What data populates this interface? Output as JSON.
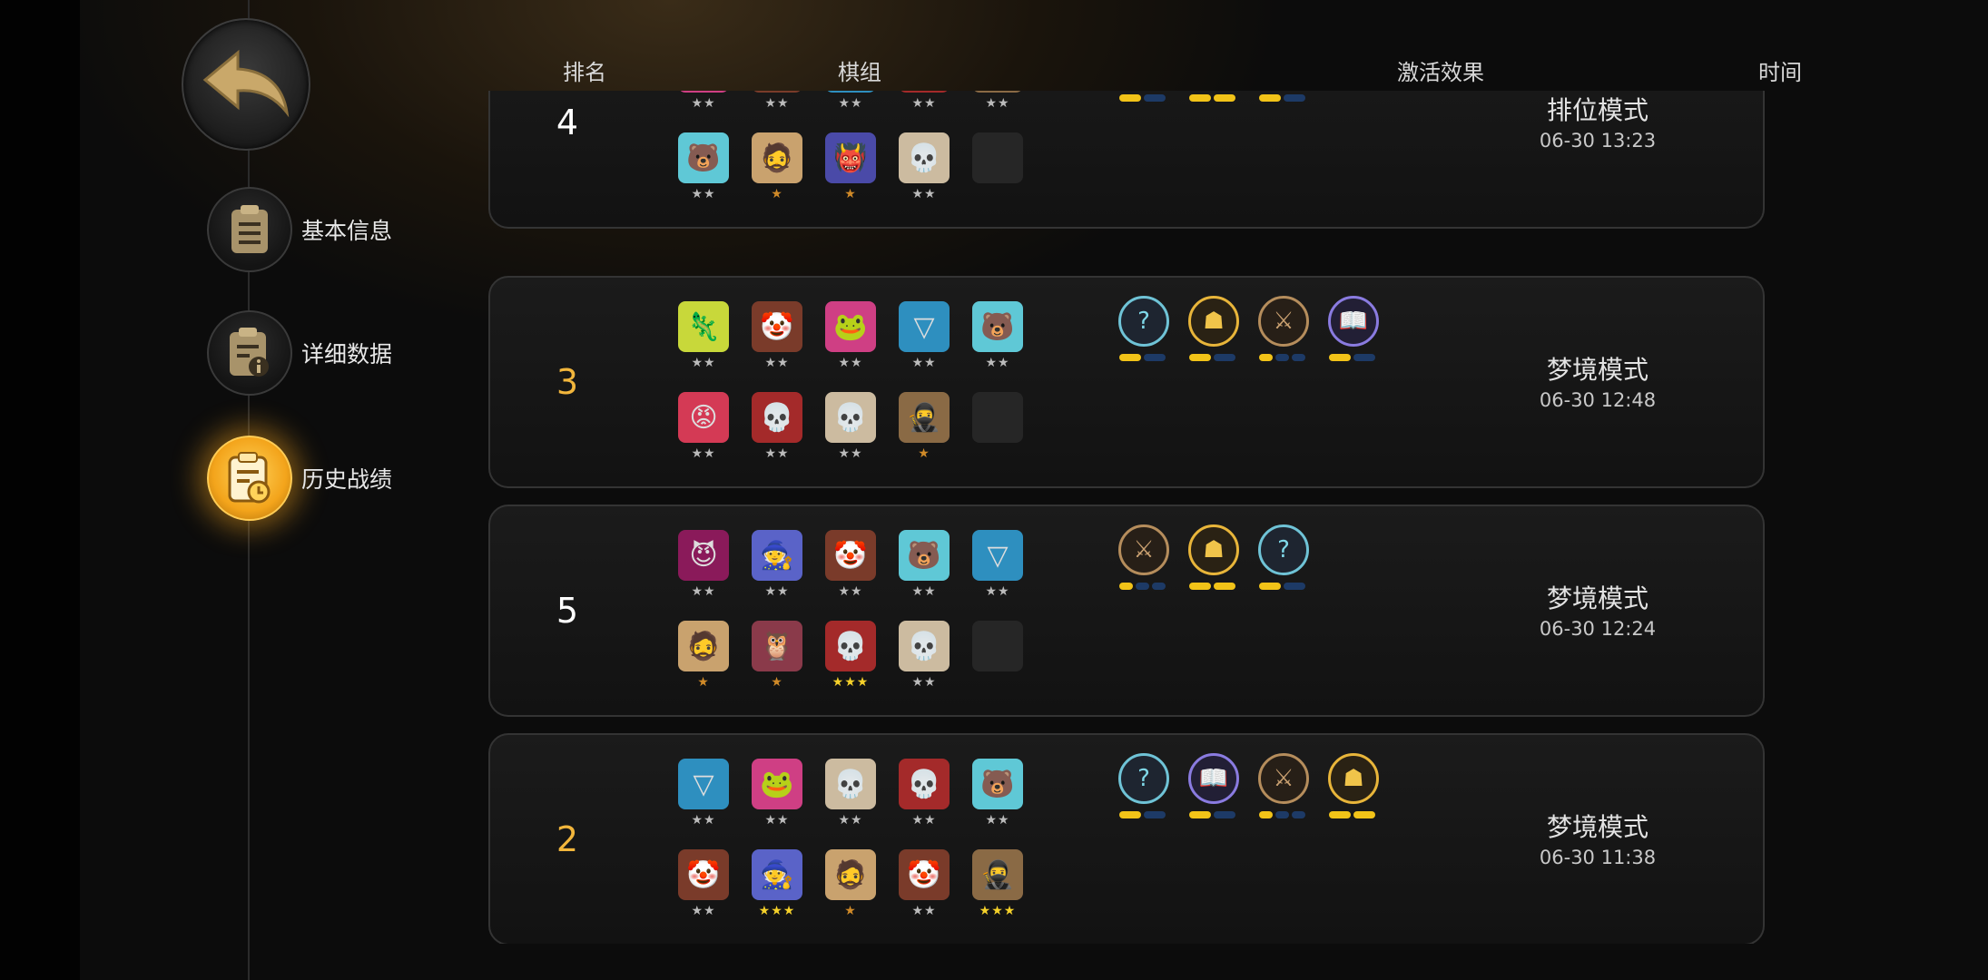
{
  "nav": {
    "back_label": "",
    "items": [
      {
        "label": "基本信息",
        "icon": "clipboard-icon",
        "active": false
      },
      {
        "label": "详细数据",
        "icon": "clipboard-info-icon",
        "active": false
      },
      {
        "label": "历史战绩",
        "icon": "clipboard-history-icon",
        "active": true
      }
    ]
  },
  "header": {
    "rank": "排名",
    "pieces": "棋组",
    "effects": "激活效果",
    "time": "时间"
  },
  "records": [
    {
      "rank": "4",
      "rank_gold": false,
      "mode": "排位模式",
      "time": "06-30 13:23",
      "pieces_row1": [
        {
          "icon": "🐸",
          "bg": "#cf3f84",
          "stars": "★★"
        },
        {
          "icon": "🤡",
          "bg": "#7a3b2a",
          "stars": "★★"
        },
        {
          "icon": "▽",
          "bg": "#2e8fbf",
          "stars": "★★"
        },
        {
          "icon": "💀",
          "bg": "#a42a2a",
          "stars": "★★"
        },
        {
          "icon": "🥷",
          "bg": "#8a6a45",
          "stars": "★★"
        }
      ],
      "pieces_row2": [
        {
          "icon": "🐻",
          "bg": "#5fc8d6",
          "stars": "★★"
        },
        {
          "icon": "🧔",
          "bg": "#c9a26e",
          "stars": "★"
        },
        {
          "icon": "👹",
          "bg": "#4a4aa8",
          "stars": "★"
        },
        {
          "icon": "💀",
          "bg": "#ccbba0",
          "stars": "★★"
        },
        {
          "icon": "",
          "bg": "empty",
          "stars": ""
        }
      ],
      "effects": [
        {
          "icon": "📖",
          "kind": "purple",
          "bars": [
            1,
            0
          ]
        },
        {
          "icon": "☗",
          "kind": "gold",
          "bars": [
            1,
            1
          ]
        },
        {
          "icon": "?",
          "kind": "teal",
          "bars": [
            1,
            0
          ]
        }
      ]
    },
    {
      "rank": "3",
      "rank_gold": true,
      "mode": "梦境模式",
      "time": "06-30 12:48",
      "pieces_row1": [
        {
          "icon": "🦎",
          "bg": "#c8d83a",
          "stars": "★★"
        },
        {
          "icon": "🤡",
          "bg": "#7a3b2a",
          "stars": "★★"
        },
        {
          "icon": "🐸",
          "bg": "#cf3f84",
          "stars": "★★"
        },
        {
          "icon": "▽",
          "bg": "#2e8fbf",
          "stars": "★★"
        },
        {
          "icon": "🐻",
          "bg": "#5fc8d6",
          "stars": "★★"
        }
      ],
      "pieces_row2": [
        {
          "icon": "😡",
          "bg": "#d43a55",
          "stars": "★★"
        },
        {
          "icon": "💀",
          "bg": "#a42a2a",
          "stars": "★★"
        },
        {
          "icon": "💀",
          "bg": "#ccbba0",
          "stars": "★★"
        },
        {
          "icon": "🥷",
          "bg": "#8a6a45",
          "stars": "★"
        },
        {
          "icon": "",
          "bg": "empty",
          "stars": ""
        }
      ],
      "effects": [
        {
          "icon": "?",
          "kind": "teal",
          "bars": [
            1,
            0
          ]
        },
        {
          "icon": "☗",
          "kind": "gold",
          "bars": [
            1,
            0
          ]
        },
        {
          "icon": "⚔",
          "kind": "bronze",
          "bars": [
            1,
            0,
            0
          ]
        },
        {
          "icon": "📖",
          "kind": "purple",
          "bars": [
            1,
            0
          ]
        }
      ]
    },
    {
      "rank": "5",
      "rank_gold": false,
      "mode": "梦境模式",
      "time": "06-30 12:24",
      "pieces_row1": [
        {
          "icon": "😈",
          "bg": "#8a1a5a",
          "stars": "★★"
        },
        {
          "icon": "🧙",
          "bg": "#5a63c8",
          "stars": "★★"
        },
        {
          "icon": "🤡",
          "bg": "#7a3b2a",
          "stars": "★★"
        },
        {
          "icon": "🐻",
          "bg": "#5fc8d6",
          "stars": "★★"
        },
        {
          "icon": "▽",
          "bg": "#2e8fbf",
          "stars": "★★"
        }
      ],
      "pieces_row2": [
        {
          "icon": "🧔",
          "bg": "#c9a26e",
          "stars": "★"
        },
        {
          "icon": "🦉",
          "bg": "#8a3a4a",
          "stars": "★"
        },
        {
          "icon": "💀",
          "bg": "#a42a2a",
          "stars": "★★★"
        },
        {
          "icon": "💀",
          "bg": "#ccbba0",
          "stars": "★★"
        },
        {
          "icon": "",
          "bg": "empty",
          "stars": ""
        }
      ],
      "effects": [
        {
          "icon": "⚔",
          "kind": "bronze",
          "bars": [
            1,
            0,
            0
          ]
        },
        {
          "icon": "☗",
          "kind": "gold",
          "bars": [
            1,
            1
          ]
        },
        {
          "icon": "?",
          "kind": "teal",
          "bars": [
            1,
            0
          ]
        }
      ]
    },
    {
      "rank": "2",
      "rank_gold": true,
      "mode": "梦境模式",
      "time": "06-30 11:38",
      "pieces_row1": [
        {
          "icon": "▽",
          "bg": "#2e8fbf",
          "stars": "★★"
        },
        {
          "icon": "🐸",
          "bg": "#cf3f84",
          "stars": "★★"
        },
        {
          "icon": "💀",
          "bg": "#ccbba0",
          "stars": "★★"
        },
        {
          "icon": "💀",
          "bg": "#a42a2a",
          "stars": "★★"
        },
        {
          "icon": "🐻",
          "bg": "#5fc8d6",
          "stars": "★★"
        }
      ],
      "pieces_row2": [
        {
          "icon": "🤡",
          "bg": "#7a3b2a",
          "stars": "★★"
        },
        {
          "icon": "🧙",
          "bg": "#5a63c8",
          "stars": "★★★"
        },
        {
          "icon": "🧔",
          "bg": "#c9a26e",
          "stars": "★"
        },
        {
          "icon": "🤡",
          "bg": "#7a3b2a",
          "stars": "★★"
        },
        {
          "icon": "🥷",
          "bg": "#8a6a45",
          "stars": "★★★"
        }
      ],
      "effects": [
        {
          "icon": "?",
          "kind": "teal",
          "bars": [
            1,
            0
          ]
        },
        {
          "icon": "📖",
          "kind": "purple",
          "bars": [
            1,
            0
          ]
        },
        {
          "icon": "⚔",
          "kind": "bronze",
          "bars": [
            1,
            0,
            0
          ]
        },
        {
          "icon": "☗",
          "kind": "gold",
          "bars": [
            1,
            1
          ]
        }
      ]
    }
  ],
  "colors": {
    "accent_gold": "#f2b63c",
    "bar_on": "#f2c318",
    "bar_off": "#1d3a66"
  }
}
